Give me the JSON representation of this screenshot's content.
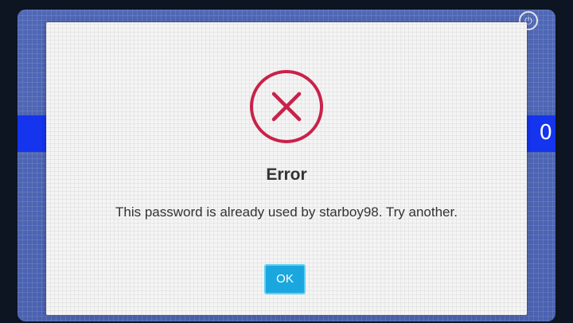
{
  "dialog": {
    "icon": "error-x-icon",
    "title": "Error",
    "message": "This password is already used by starboy98. Try another.",
    "ok_label": "OK"
  },
  "background": {
    "band_digit": "0",
    "corner_icon": "power-icon",
    "corner_glyph": "⏻"
  },
  "colors": {
    "icon_ring": "#c8224a",
    "ok_button": "#1aa7df",
    "band": "#1434ee",
    "background_screen": "#4f67b6"
  }
}
